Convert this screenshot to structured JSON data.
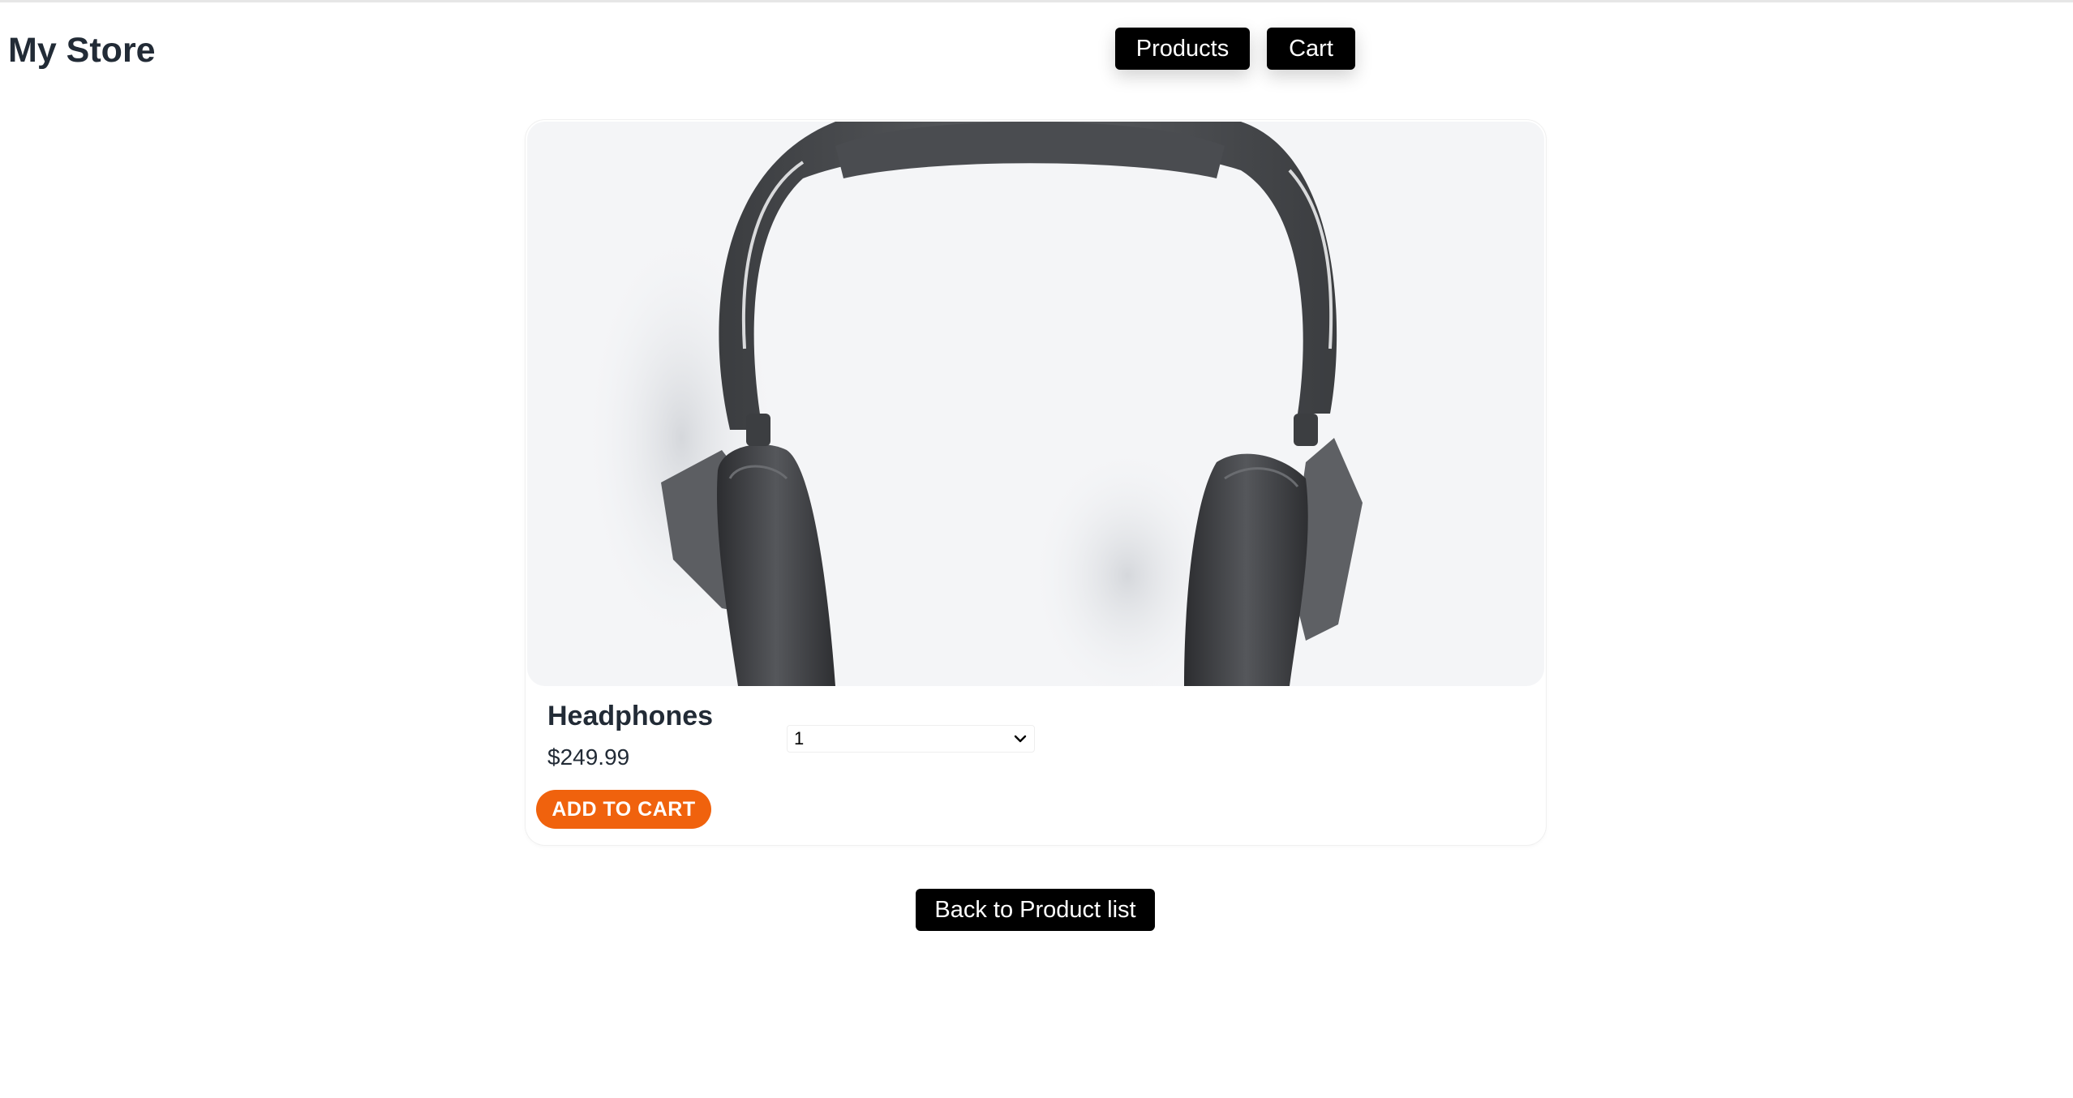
{
  "header": {
    "brand": "My Store",
    "nav": {
      "products_label": "Products",
      "cart_label": "Cart"
    }
  },
  "product": {
    "name": "Headphones",
    "price": "$249.99",
    "quantity_selected": "1",
    "add_to_cart_label": "ADD TO CART",
    "image_icon": "headphones-photo"
  },
  "footer": {
    "back_label": "Back to Product list"
  },
  "colors": {
    "accent": "#f0620d",
    "button_dark": "#000000",
    "text": "#222b36",
    "image_bg": "#f4f5f7"
  }
}
